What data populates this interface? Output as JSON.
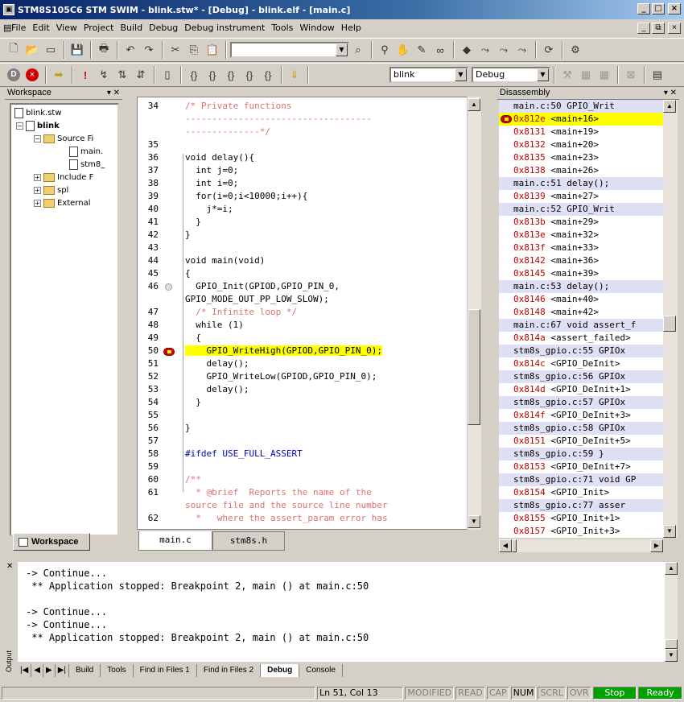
{
  "window": {
    "title": "STM8S105C6 STM SWIM - blink.stw* - [Debug] - blink.elf - [main.c]"
  },
  "menu": [
    "File",
    "Edit",
    "View",
    "Project",
    "Build",
    "Debug",
    "Debug instrument",
    "Tools",
    "Window",
    "Help"
  ],
  "toolbar": {
    "config_select": "blink",
    "mode_select": "Debug"
  },
  "workspace": {
    "title": "Workspace",
    "tab": "Workspace",
    "tree": [
      "blink.stw",
      "blink",
      "Source Fi",
      "main.",
      "stm8_",
      "Include F",
      "spl",
      "External"
    ]
  },
  "editor": {
    "tabs": [
      "main.c",
      "stm8s.h"
    ],
    "lines": [
      {
        "n": "34",
        "t": "/* Private functions"
      },
      {
        "n": "",
        "t": "-----------------------------------"
      },
      {
        "n": "",
        "t": "--------------*/"
      },
      {
        "n": "35",
        "t": ""
      },
      {
        "n": "36",
        "t": "void delay(){"
      },
      {
        "n": "37",
        "t": "  int j=0;"
      },
      {
        "n": "38",
        "t": "  int i=0;"
      },
      {
        "n": "39",
        "t": "  for(i=0;i<10000;i++){"
      },
      {
        "n": "40",
        "t": "    j*=i;"
      },
      {
        "n": "41",
        "t": "  }"
      },
      {
        "n": "42",
        "t": "}"
      },
      {
        "n": "43",
        "t": ""
      },
      {
        "n": "44",
        "t": "void main(void)"
      },
      {
        "n": "45",
        "t": "{"
      },
      {
        "n": "46",
        "t": "  GPIO_Init(GPIOD,GPIO_PIN_0,"
      },
      {
        "n": "",
        "t": "GPIO_MODE_OUT_PP_LOW_SLOW);"
      },
      {
        "n": "47",
        "t": "  /* Infinite loop */"
      },
      {
        "n": "48",
        "t": "  while (1)"
      },
      {
        "n": "49",
        "t": "  {"
      },
      {
        "n": "50",
        "t": "    GPIO_WriteHigh(GPIOD,GPIO_PIN_0);"
      },
      {
        "n": "51",
        "t": "    delay();"
      },
      {
        "n": "52",
        "t": "    GPIO_WriteLow(GPIOD,GPIO_PIN_0);"
      },
      {
        "n": "53",
        "t": "    delay();"
      },
      {
        "n": "54",
        "t": "  }"
      },
      {
        "n": "55",
        "t": ""
      },
      {
        "n": "56",
        "t": "}"
      },
      {
        "n": "57",
        "t": ""
      },
      {
        "n": "58",
        "t": "#ifdef USE_FULL_ASSERT"
      },
      {
        "n": "59",
        "t": ""
      },
      {
        "n": "60",
        "t": "/**"
      },
      {
        "n": "61",
        "t": "  * @brief  Reports the name of the"
      },
      {
        "n": "",
        "t": "source file and the source line number"
      },
      {
        "n": "62",
        "t": "  *   where the assert_param error has"
      }
    ]
  },
  "disassembly": {
    "title": "Disassembly",
    "lines": [
      {
        "a": "main.c:50",
        "b": "     GPIO_Writ",
        "s": 1
      },
      {
        "a": "0x812e",
        "b": " <main+16>",
        "s": 0,
        "cur": 1
      },
      {
        "a": "0x8131",
        "b": " <main+19>",
        "s": 0
      },
      {
        "a": "0x8132",
        "b": " <main+20>",
        "s": 0
      },
      {
        "a": "0x8135",
        "b": " <main+23>",
        "s": 0
      },
      {
        "a": "0x8138",
        "b": " <main+26>",
        "s": 0
      },
      {
        "a": "main.c:51",
        "b": "     delay();",
        "s": 1
      },
      {
        "a": "0x8139",
        "b": " <main+27>",
        "s": 0
      },
      {
        "a": "main.c:52",
        "b": "     GPIO_Writ",
        "s": 1
      },
      {
        "a": "0x813b",
        "b": " <main+29>",
        "s": 0
      },
      {
        "a": "0x813e",
        "b": " <main+32>",
        "s": 0
      },
      {
        "a": "0x813f",
        "b": " <main+33>",
        "s": 0
      },
      {
        "a": "0x8142",
        "b": " <main+36>",
        "s": 0
      },
      {
        "a": "0x8145",
        "b": " <main+39>",
        "s": 0
      },
      {
        "a": "main.c:53",
        "b": "     delay();",
        "s": 1
      },
      {
        "a": "0x8146",
        "b": " <main+40>",
        "s": 0
      },
      {
        "a": "0x8148",
        "b": " <main+42>",
        "s": 0
      },
      {
        "a": "main.c:67",
        "b": " void assert_f",
        "s": 1
      },
      {
        "a": "0x814a",
        "b": " <assert_failed>",
        "s": 0
      },
      {
        "a": "stm8s_gpio.c:55",
        "b": "   GPIOx",
        "s": 1
      },
      {
        "a": "0x814c",
        "b": " <GPIO_DeInit>",
        "s": 0
      },
      {
        "a": "stm8s_gpio.c:56",
        "b": "   GPIOx",
        "s": 1
      },
      {
        "a": "0x814d",
        "b": " <GPIO_DeInit+1>",
        "s": 0
      },
      {
        "a": "stm8s_gpio.c:57",
        "b": "   GPIOx",
        "s": 1
      },
      {
        "a": "0x814f",
        "b": " <GPIO_DeInit+3>",
        "s": 0
      },
      {
        "a": "stm8s_gpio.c:58",
        "b": "   GPIOx",
        "s": 1
      },
      {
        "a": "0x8151",
        "b": " <GPIO_DeInit+5>",
        "s": 0
      },
      {
        "a": "stm8s_gpio.c:59",
        "b": " }",
        "s": 1
      },
      {
        "a": "0x8153",
        "b": " <GPIO_DeInit+7>",
        "s": 0
      },
      {
        "a": "stm8s_gpio.c:71",
        "b": " void GP",
        "s": 1
      },
      {
        "a": "0x8154",
        "b": " <GPIO_Init>",
        "s": 0
      },
      {
        "a": "stm8s_gpio.c:77",
        "b": "   asser",
        "s": 1
      },
      {
        "a": "0x8155",
        "b": " <GPIO_Init+1>",
        "s": 0
      },
      {
        "a": "0x8157",
        "b": " <GPIO_Init+3>",
        "s": 0
      }
    ]
  },
  "output": {
    "label": "Output",
    "lines": [
      "-> Continue...",
      " ** Application stopped: Breakpoint 2, main () at main.c:50",
      "",
      "-> Continue...",
      "-> Continue...",
      " ** Application stopped: Breakpoint 2, main () at main.c:50"
    ],
    "tabs": [
      "Build",
      "Tools",
      "Find in Files 1",
      "Find in Files 2",
      "Debug",
      "Console"
    ]
  },
  "status": {
    "position": "Ln 51, Col 13",
    "indicators": [
      "MODIFIED",
      "READ",
      "CAP",
      "NUM",
      "SCRL",
      "OVR"
    ],
    "run_state": "Stop",
    "ready": "Ready"
  }
}
